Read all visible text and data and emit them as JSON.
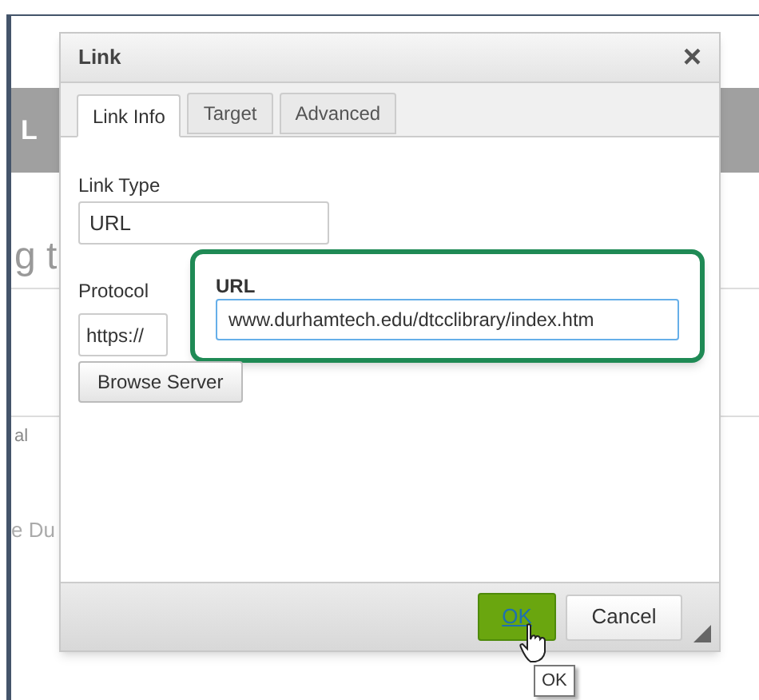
{
  "background": {
    "fragments": [
      "L",
      "g t",
      "al",
      "e Du"
    ]
  },
  "dialog": {
    "title": "Link",
    "close": "×",
    "tabs": [
      {
        "label": "Link Info",
        "selected": true
      },
      {
        "label": "Target",
        "selected": false
      },
      {
        "label": "Advanced",
        "selected": false
      }
    ],
    "link_type": {
      "label": "Link Type",
      "value": "URL"
    },
    "protocol": {
      "label": "Protocol",
      "value": "https://"
    },
    "url": {
      "label": "URL",
      "value": "www.durhamtech.edu/dtcclibrary/index.htm",
      "highlighted": true
    },
    "browse_button": "Browse Server",
    "buttons": [
      {
        "label": "OK",
        "kind": "primary"
      },
      {
        "label": "Cancel",
        "kind": "secondary"
      }
    ],
    "tooltip": "OK"
  }
}
